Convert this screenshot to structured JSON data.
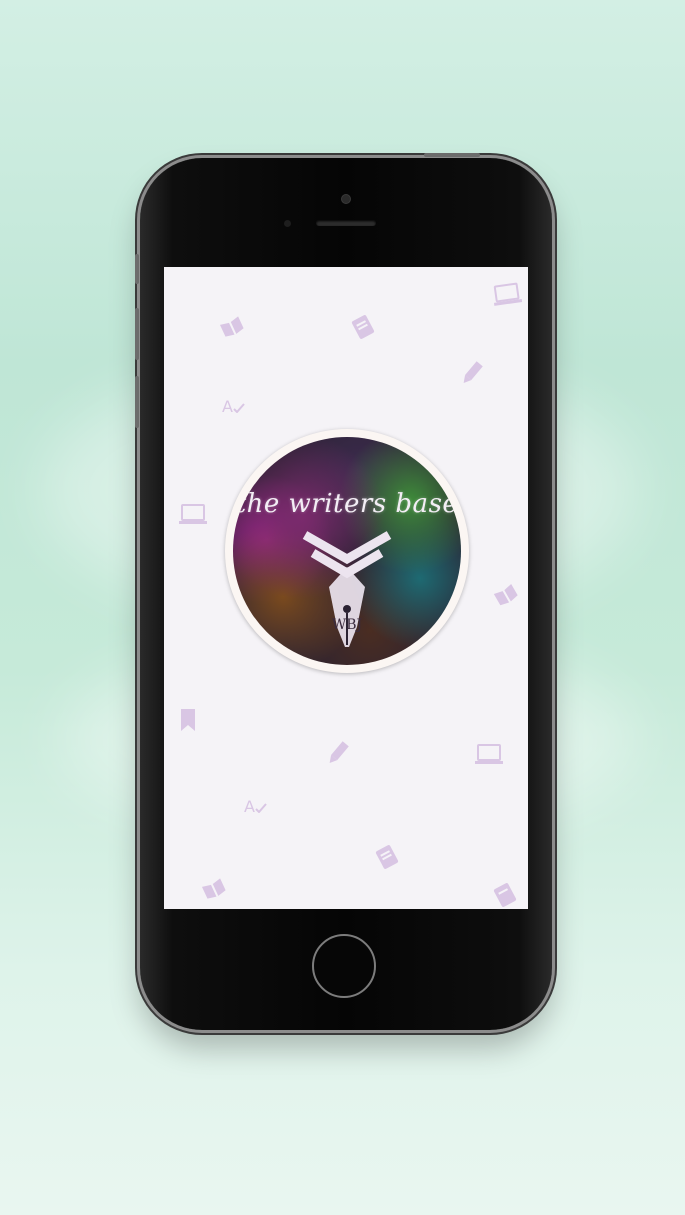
{
  "app": {
    "name": "the writers base",
    "monogram": "WBJ"
  },
  "screen": {
    "background": "#f5f3f7",
    "decoration_color": "#d9c6e4",
    "decorations": [
      "book-icon",
      "notebook-icon",
      "laptop-icon",
      "pencil-icon",
      "spellcheck-icon",
      "bookmark-icon"
    ],
    "spellcheck_glyph": "A"
  },
  "device": {
    "frame_color": "#050505",
    "bezel_color": "#8c8c8c"
  }
}
